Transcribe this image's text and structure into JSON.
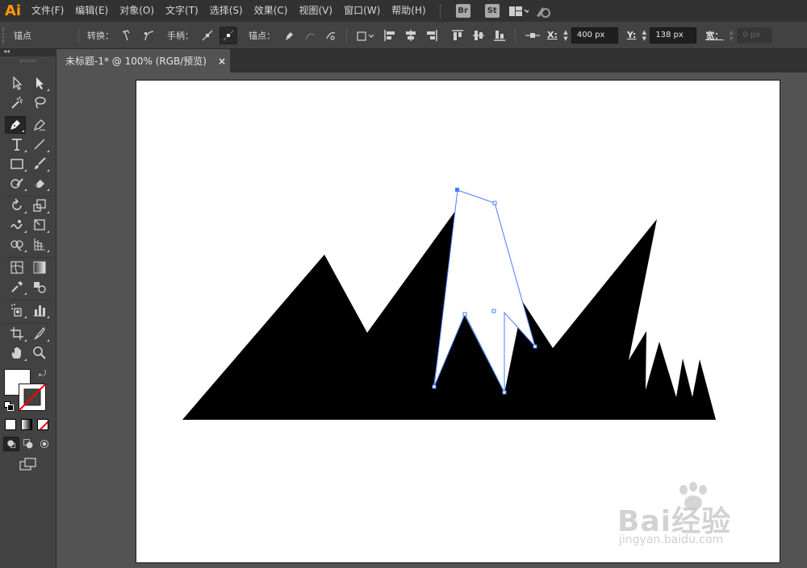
{
  "app": {
    "logo": "Ai"
  },
  "menu": {
    "items": [
      "文件(F)",
      "编辑(E)",
      "对象(O)",
      "文字(T)",
      "选择(S)",
      "效果(C)",
      "视图(V)",
      "窗口(W)",
      "帮助(H)"
    ],
    "bridge": "Br",
    "stock": "St"
  },
  "control": {
    "mode_label": "锚点",
    "convert_label": "转换：",
    "handles_label": "手柄：",
    "anchors_label": "锚点：",
    "x_label": "X:",
    "x_value": "400 px",
    "y_label": "Y:",
    "y_value": "138 px",
    "width_label": "宽：",
    "width_value": "0 px"
  },
  "document": {
    "tab_title": "未标题-1* @ 100% (RGB/预览)",
    "close_glyph": "×"
  },
  "watermark": {
    "brand": "Bai经验",
    "url": "jingyan.baidu.com"
  },
  "colors": {
    "path_selection": "#4a7cff",
    "fill": "#000000",
    "stroke_none": "#ff0000",
    "app_accent": "#ff9a00"
  }
}
